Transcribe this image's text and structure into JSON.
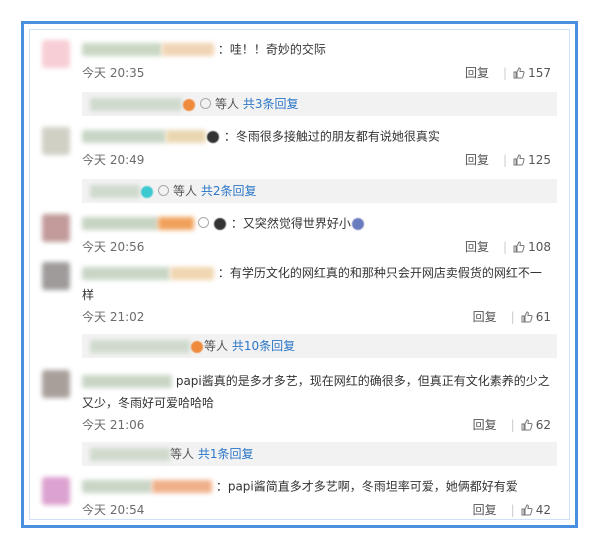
{
  "like_icon": "thumbs-up-icon",
  "colors": {
    "accent": "#2c76c7",
    "frame": "#4a8fe0"
  },
  "comments": [
    {
      "text": "：哇！！奇妙的交际",
      "time": "今天 20:35",
      "reply": "回复",
      "likes": "157"
    },
    {
      "text": "：冬雨很多接触过的朋友都有说她很真实",
      "time": "今天 20:49",
      "reply": "回复",
      "likes": "125"
    },
    {
      "text": "：又突然觉得世界好小",
      "time": "今天 20:56",
      "reply": "回复",
      "likes": "108"
    },
    {
      "text": "：有学历文化的网红真的和那种只会开网店卖假货的网红不一样",
      "time": "今天 21:02",
      "reply": "回复",
      "likes": "61"
    },
    {
      "text": "papi酱真的是多才多艺，现在网红的确很多，但真正有文化素养的少之又少，冬雨好可爱哈哈哈",
      "time": "今天 21:06",
      "reply": "回复",
      "likes": "62"
    },
    {
      "text": "：papi酱简直多才多艺啊，冬雨坦率可爱，她俩都好有爱",
      "time": "今天 20:54",
      "reply": "回复",
      "likes": "42"
    }
  ],
  "subreplies": [
    {
      "prefix": "等人",
      "count": "共3条回复"
    },
    {
      "prefix": "等人",
      "count": "共2条回复"
    },
    {
      "prefix": "等人",
      "count": "共10条回复"
    },
    {
      "prefix": "等人",
      "count": "共1条回复"
    }
  ]
}
